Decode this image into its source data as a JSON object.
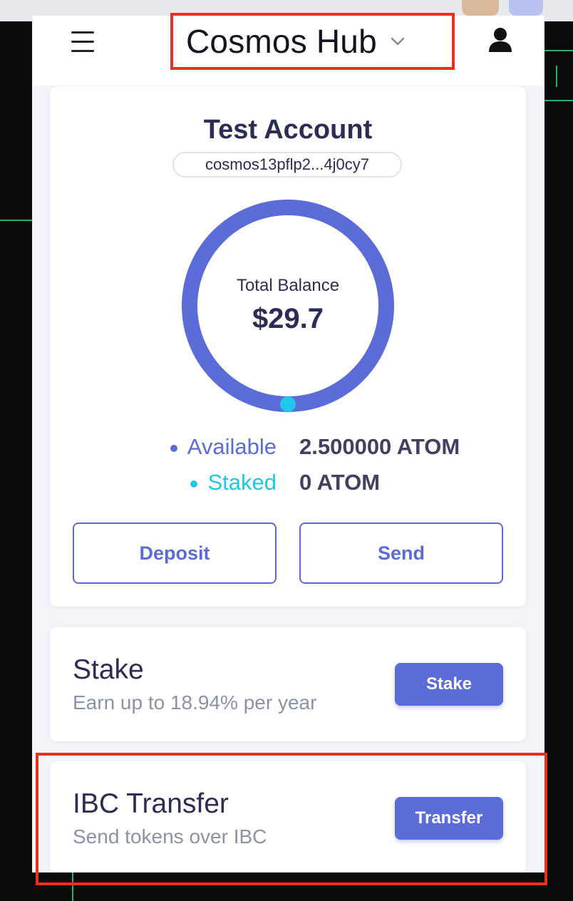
{
  "header": {
    "network_name": "Cosmos Hub"
  },
  "account": {
    "name": "Test Account",
    "address": "cosmos13pflp2...4j0cy7",
    "total_balance_label": "Total Balance",
    "total_balance_value": "$29.7",
    "balances": [
      {
        "label": "Available",
        "value": "2.500000 ATOM",
        "color": "#5b6bd8"
      },
      {
        "label": "Staked",
        "value": "0 ATOM",
        "color": "#1fc8e8"
      }
    ],
    "deposit_label": "Deposit",
    "send_label": "Send"
  },
  "stake": {
    "title": "Stake",
    "subtitle": "Earn up to 18.94% per year",
    "button_label": "Stake"
  },
  "ibc": {
    "title": "IBC Transfer",
    "subtitle": "Send tokens over IBC",
    "button_label": "Transfer"
  },
  "colors": {
    "accent": "#5b6bd8",
    "staked": "#1fc8e8",
    "highlight": "#e8321e",
    "text_dark": "#2b2d54"
  }
}
